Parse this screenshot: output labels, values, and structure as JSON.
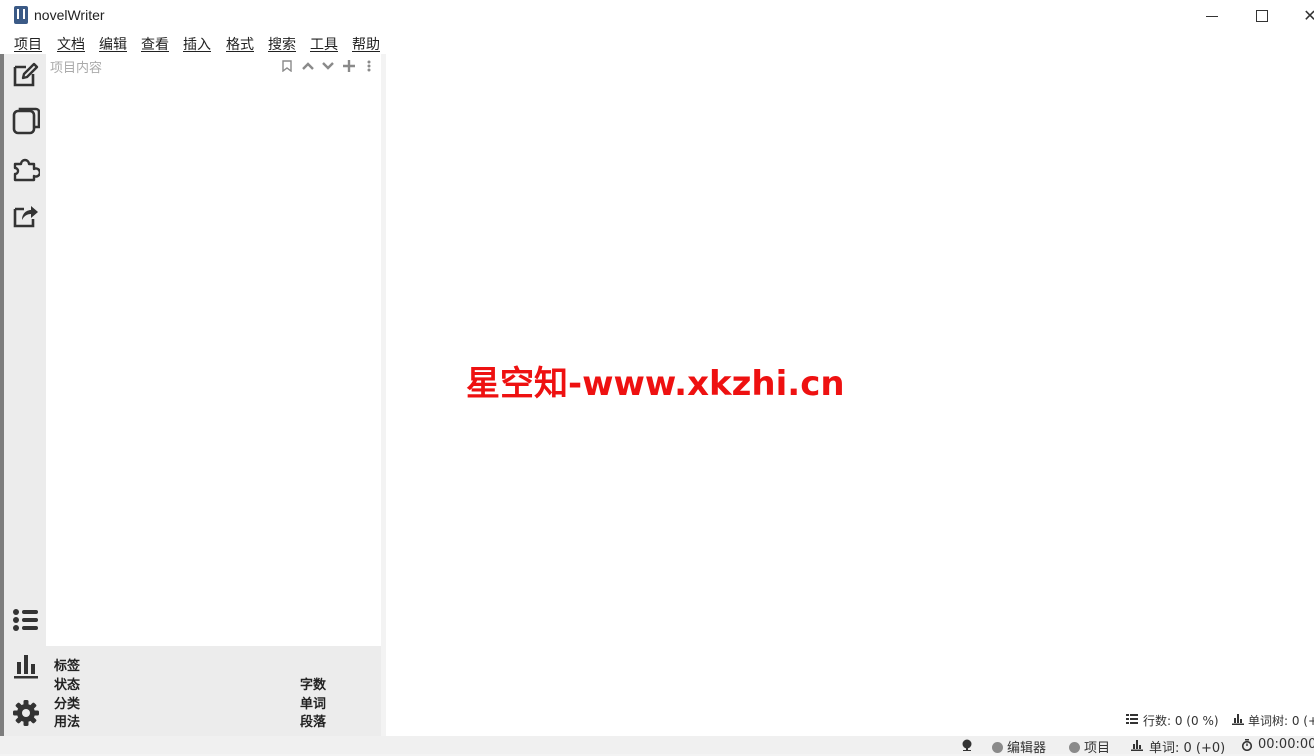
{
  "window": {
    "title": "novelWriter",
    "close_glyph": "✕"
  },
  "menu": {
    "items": [
      "项目",
      "文档",
      "编辑",
      "查看",
      "插入",
      "格式",
      "搜索",
      "工具",
      "帮助"
    ]
  },
  "sidebar": {
    "icons": [
      "edit-icon",
      "novel-view-icon",
      "outline-icon",
      "build-icon",
      "list-icon",
      "stats-icon",
      "settings-icon"
    ]
  },
  "project_tree": {
    "header": "项目内容",
    "tools": [
      "bookmark-icon",
      "move-up-icon",
      "move-down-icon",
      "add-icon",
      "menu-icon"
    ]
  },
  "details": {
    "tags_label": "标签",
    "status_label": "状态",
    "class_label": "分类",
    "usage_label": "用法",
    "chars_label": "字数",
    "words_label": "单词",
    "paragraphs_label": "段落"
  },
  "editor": {
    "watermark": "星空知-www.xkzhi.cn",
    "lines_label": "行数: 0 (0 %)",
    "words_label": "单词树: 0 (+"
  },
  "statusbar": {
    "editor_label": "编辑器",
    "project_label": "项目",
    "word_count": "单词: 0 (+0)",
    "timer": "00:00:00"
  },
  "colors": {
    "watermark": "#ee1111",
    "sidebar_edge": "#7d7d7d"
  }
}
